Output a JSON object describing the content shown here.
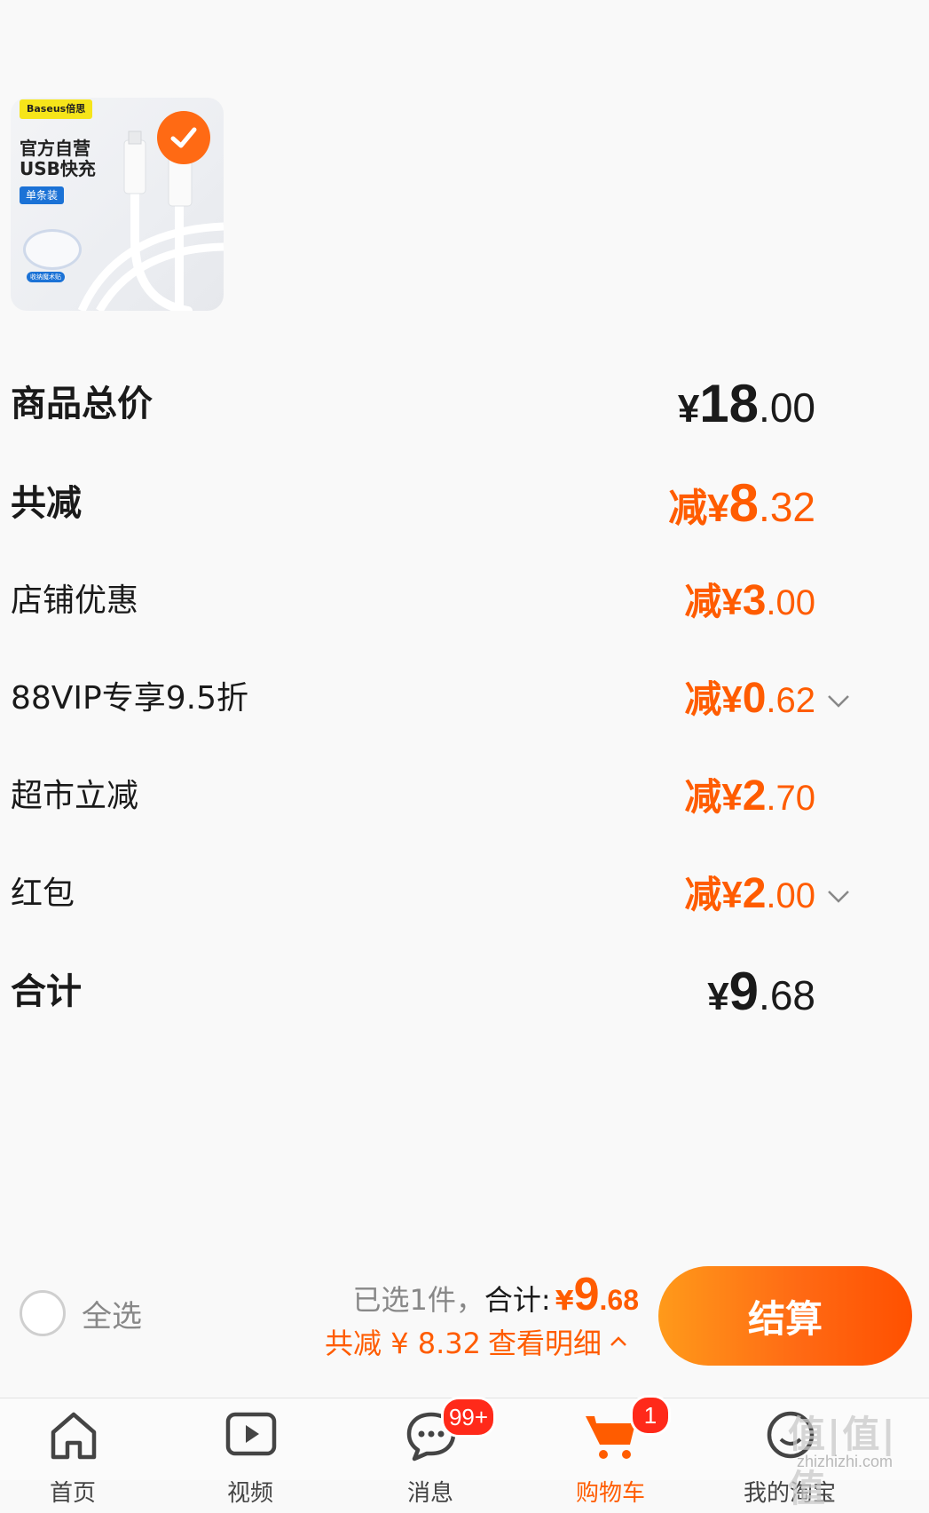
{
  "product": {
    "brand": "Baseus倍思",
    "line1": "官方自营",
    "line2": "USB快充",
    "pack": "单条装",
    "strap_label": "收纳魔术贴",
    "selected": true
  },
  "breakdown": {
    "goods_total": {
      "label": "商品总价",
      "currency": "¥",
      "integer": "18",
      "decimal": ".00"
    },
    "total_reduced": {
      "label": "共减",
      "prefix": "减¥",
      "integer": "8",
      "decimal": ".32"
    },
    "store_discount": {
      "label": "店铺优惠",
      "prefix": "减¥",
      "integer": "3",
      "decimal": ".00"
    },
    "vip_discount": {
      "label": "88VIP专享9.5折",
      "prefix": "减¥",
      "integer": "0",
      "decimal": ".62"
    },
    "supermarket_discount": {
      "label": "超市立减",
      "prefix": "减¥",
      "integer": "2",
      "decimal": ".70"
    },
    "red_packet": {
      "label": "红包",
      "prefix": "减¥",
      "integer": "2",
      "decimal": ".00"
    },
    "sum": {
      "label": "合计",
      "currency": "¥",
      "integer": "9",
      "decimal": ".68"
    }
  },
  "checkout_bar": {
    "select_all_label": "全选",
    "selected_count": "已选1件，",
    "total_label": "合计:",
    "total_currency": "¥",
    "total_integer": "9",
    "total_decimal": ".68",
    "reduced_text": "共减 ¥ 8.32",
    "detail_link": "查看明细",
    "checkout_label": "结算"
  },
  "tabbar": {
    "tabs": [
      {
        "label": "首页"
      },
      {
        "label": "视频"
      },
      {
        "label": "消息",
        "badge": "99+"
      },
      {
        "label": "购物车",
        "badge": "1"
      },
      {
        "label": "我的淘宝"
      }
    ]
  },
  "watermark": {
    "text": "值|值|值",
    "site": "zhizhizhi.com"
  },
  "colors": {
    "accent": "#ff5c00",
    "badge": "#ff2a1a",
    "check": "#ff6a14"
  }
}
